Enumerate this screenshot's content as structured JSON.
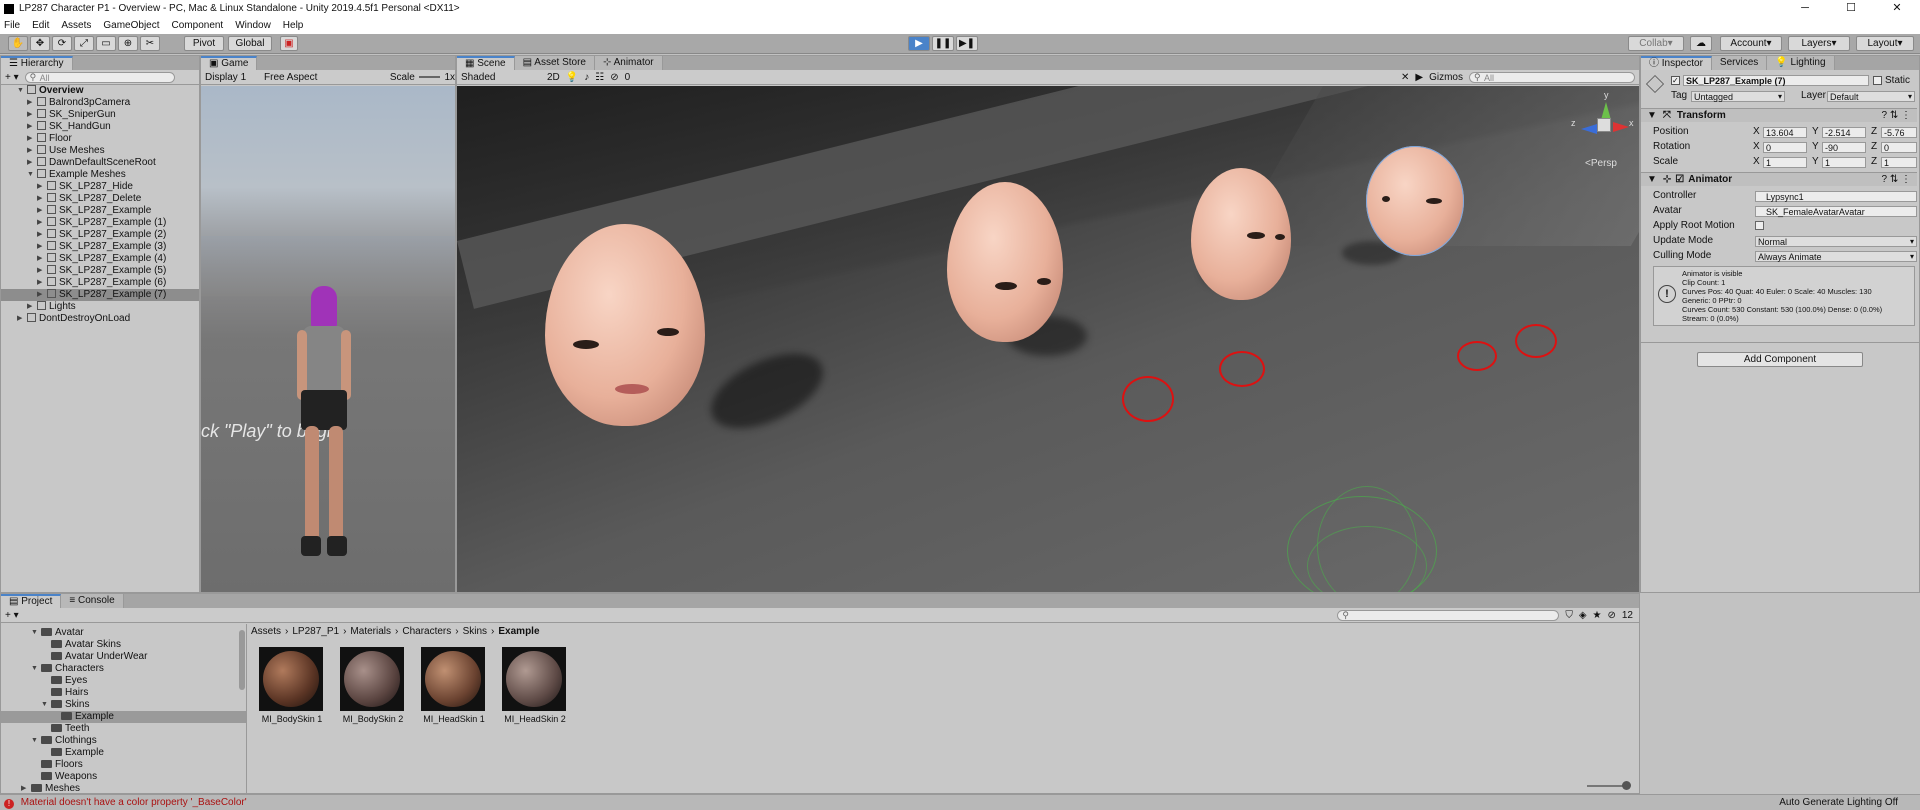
{
  "titlebar": {
    "title": "LP287 Character P1 - Overview - PC, Mac & Linux Standalone - Unity 2019.4.5f1 Personal <DX11>",
    "min": "─",
    "max": "☐",
    "close": "✕"
  },
  "menu": [
    "File",
    "Edit",
    "Assets",
    "GameObject",
    "Component",
    "Window",
    "Help"
  ],
  "toolbar": {
    "pivot": "Pivot",
    "global": "Global",
    "collab": "Collab",
    "account": "Account",
    "layers": "Layers",
    "layout": "Layout"
  },
  "hierarchy": {
    "tab": "Hierarchy",
    "search_placeholder": "All",
    "add": "+ ▾",
    "items": [
      {
        "label": "Overview",
        "indent": 0,
        "arrow": "▼",
        "bold": true
      },
      {
        "label": "Balrond3pCamera",
        "indent": 1,
        "arrow": "▶"
      },
      {
        "label": "SK_SniperGun",
        "indent": 1,
        "arrow": "▶"
      },
      {
        "label": "SK_HandGun",
        "indent": 1,
        "arrow": "▶"
      },
      {
        "label": "Floor",
        "indent": 1,
        "arrow": "▶"
      },
      {
        "label": "Use Meshes",
        "indent": 1,
        "arrow": "▶"
      },
      {
        "label": "DawnDefaultSceneRoot",
        "indent": 1,
        "arrow": "▶"
      },
      {
        "label": "Example Meshes",
        "indent": 1,
        "arrow": "▼"
      },
      {
        "label": "SK_LP287_Hide",
        "indent": 2,
        "arrow": "▶"
      },
      {
        "label": "SK_LP287_Delete",
        "indent": 2,
        "arrow": "▶"
      },
      {
        "label": "SK_LP287_Example",
        "indent": 2,
        "arrow": "▶"
      },
      {
        "label": "SK_LP287_Example (1)",
        "indent": 2,
        "arrow": "▶"
      },
      {
        "label": "SK_LP287_Example (2)",
        "indent": 2,
        "arrow": "▶"
      },
      {
        "label": "SK_LP287_Example (3)",
        "indent": 2,
        "arrow": "▶"
      },
      {
        "label": "SK_LP287_Example (4)",
        "indent": 2,
        "arrow": "▶"
      },
      {
        "label": "SK_LP287_Example (5)",
        "indent": 2,
        "arrow": "▶"
      },
      {
        "label": "SK_LP287_Example (6)",
        "indent": 2,
        "arrow": "▶"
      },
      {
        "label": "SK_LP287_Example (7)",
        "indent": 2,
        "arrow": "▶",
        "selected": true
      },
      {
        "label": "Lights",
        "indent": 1,
        "arrow": "▶"
      },
      {
        "label": "DontDestroyOnLoad",
        "indent": 0,
        "arrow": "▶"
      }
    ]
  },
  "game": {
    "tab": "Game",
    "display": "Display 1",
    "aspect": "Free Aspect",
    "scale_label": "Scale",
    "scale_value": "1x",
    "overlay_text": "ck \"Play\" to begi"
  },
  "scene": {
    "tabs": [
      "Scene",
      "Asset Store",
      "Animator"
    ],
    "shading": "Shaded",
    "mode2d": "2D",
    "hidden_count": "0",
    "gizmos": "Gizmos",
    "search_placeholder": "All",
    "persp": "<Persp",
    "axis_y": "y",
    "axis_x": "x",
    "axis_z": "z"
  },
  "inspector": {
    "tabs": [
      "Inspector",
      "Services",
      "Lighting"
    ],
    "object_name": "SK_LP287_Example (7)",
    "static": "Static",
    "tag_label": "Tag",
    "tag": "Untagged",
    "layer_label": "Layer",
    "layer": "Default",
    "transform": {
      "title": "Transform",
      "position_label": "Position",
      "rotation_label": "Rotation",
      "scale_label": "Scale",
      "position": {
        "x": "13.604",
        "y": "-2.514",
        "z": "-5.76"
      },
      "rotation": {
        "x": "0",
        "y": "-90",
        "z": "0"
      },
      "scale": {
        "x": "1",
        "y": "1",
        "z": "1"
      }
    },
    "animator": {
      "title": "Animator",
      "controller_label": "Controller",
      "controller": "Lypsync1",
      "avatar_label": "Avatar",
      "avatar": "SK_FemaleAvatarAvatar",
      "root_motion_label": "Apply Root Motion",
      "update_mode_label": "Update Mode",
      "update_mode": "Normal",
      "culling_label": "Culling Mode",
      "culling": "Always Animate",
      "info": [
        "Animator is visible",
        "Clip Count: 1",
        "Curves Pos: 40 Quat: 40 Euler: 0 Scale: 40 Muscles: 130",
        "Generic: 0 PPtr: 0",
        "Curves Count: 530 Constant: 530 (100.0%) Dense: 0 (0.0%)",
        "Stream: 0 (0.0%)"
      ]
    },
    "add_component": "Add Component"
  },
  "project": {
    "tabs": [
      "Project",
      "Console"
    ],
    "count": "12",
    "breadcrumb": [
      "Assets",
      "LP287_P1",
      "Materials",
      "Characters",
      "Skins",
      "Example"
    ],
    "tree": [
      {
        "label": "Avatar",
        "indent": 1,
        "arrow": "▼"
      },
      {
        "label": "Avatar Skins",
        "indent": 2,
        "arrow": ""
      },
      {
        "label": "Avatar UnderWear",
        "indent": 2,
        "arrow": ""
      },
      {
        "label": "Characters",
        "indent": 1,
        "arrow": "▼"
      },
      {
        "label": "Eyes",
        "indent": 2,
        "arrow": ""
      },
      {
        "label": "Hairs",
        "indent": 2,
        "arrow": ""
      },
      {
        "label": "Skins",
        "indent": 2,
        "arrow": "▼"
      },
      {
        "label": "Example",
        "indent": 3,
        "arrow": "",
        "selected": true
      },
      {
        "label": "Teeth",
        "indent": 2,
        "arrow": ""
      },
      {
        "label": "Clothings",
        "indent": 1,
        "arrow": "▼"
      },
      {
        "label": "Example",
        "indent": 2,
        "arrow": ""
      },
      {
        "label": "Floors",
        "indent": 1,
        "arrow": ""
      },
      {
        "label": "Weapons",
        "indent": 1,
        "arrow": ""
      },
      {
        "label": "Meshes",
        "indent": 0,
        "arrow": "▶"
      }
    ],
    "assets": [
      {
        "label": "MI_BodySkin 1",
        "color": "#7a4a34"
      },
      {
        "label": "MI_BodySkin 2",
        "color": "#6e5650"
      },
      {
        "label": "MI_HeadSkin 1",
        "color": "#8a5a40"
      },
      {
        "label": "MI_HeadSkin 2",
        "color": "#76605a"
      }
    ]
  },
  "statusbar": {
    "error": "Material doesn't have a color property '_BaseColor'",
    "right": "Auto Generate Lighting Off"
  }
}
